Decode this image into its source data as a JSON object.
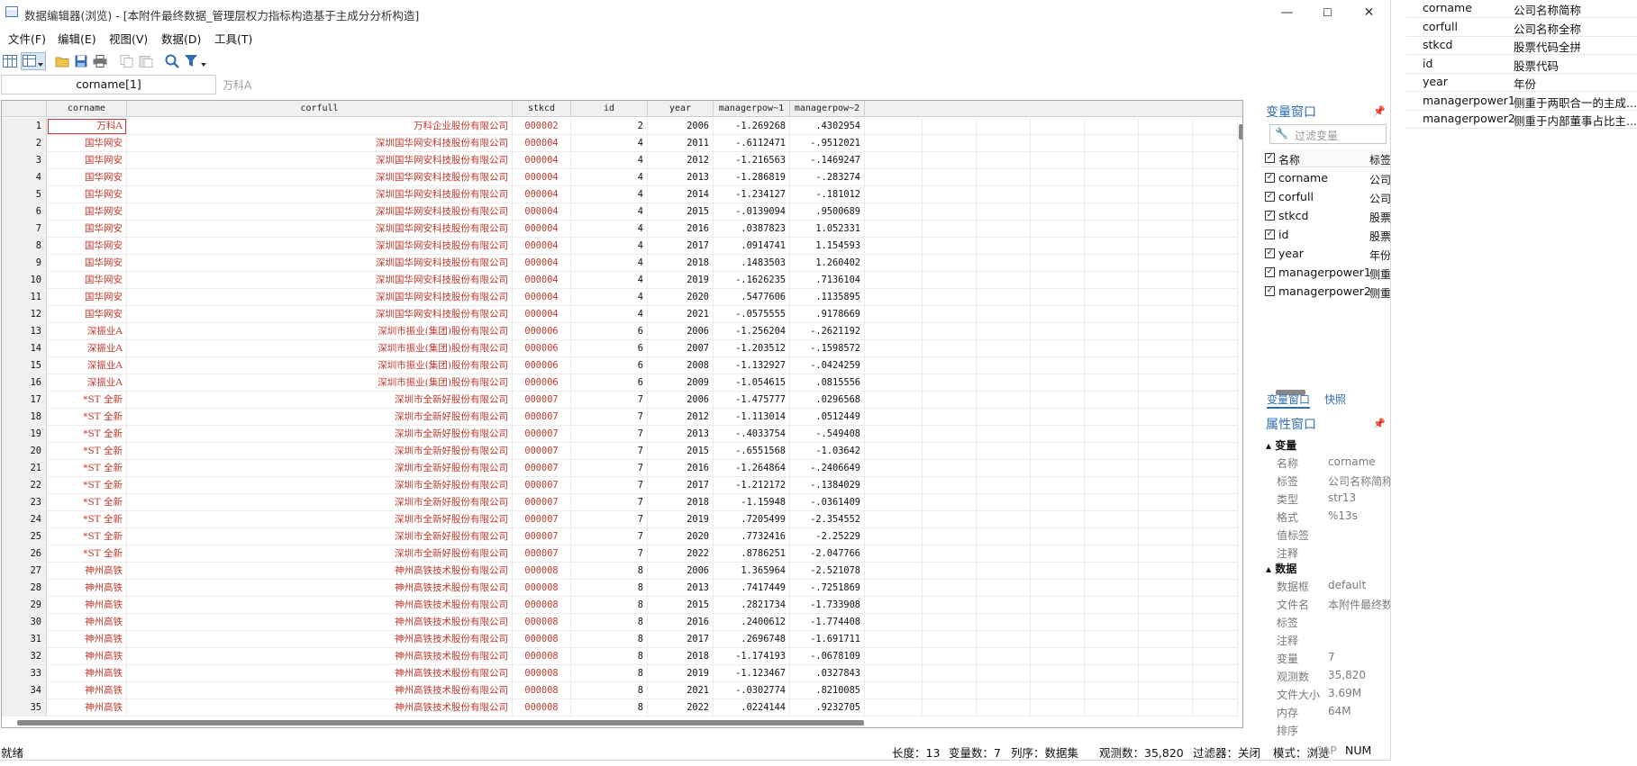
{
  "window": {
    "title": "数据编辑器(浏览) - [本附件最终数据_管理层权力指标构造基于主成分分析构造]",
    "min": "—",
    "max": "☐",
    "close": "✕"
  },
  "menu": [
    "文件(F)",
    "编辑(E)",
    "视图(V)",
    "数据(D)",
    "工具(T)"
  ],
  "toolbar": [
    "data-editor-icon",
    "browse-icon",
    "open-icon",
    "save-icon",
    "print-icon",
    "copy-icon",
    "paste-icon",
    "search-icon",
    "filter-icon"
  ],
  "cell_ref": "corname[1]",
  "cell_value": "万科A",
  "columns": [
    "corname",
    "corfull",
    "stkcd",
    "id",
    "year",
    "managerpow~1",
    "managerpow~2"
  ],
  "rows": [
    [
      "1",
      "万科A",
      "万科企业股份有限公司",
      "000002",
      "2",
      "2006",
      "-1.269268",
      ".4302954"
    ],
    [
      "2",
      "国华网安",
      "深圳国华网安科技股份有限公司",
      "000004",
      "4",
      "2011",
      "-.6112471",
      "-.9512021"
    ],
    [
      "3",
      "国华网安",
      "深圳国华网安科技股份有限公司",
      "000004",
      "4",
      "2012",
      "-1.216563",
      "-.1469247"
    ],
    [
      "4",
      "国华网安",
      "深圳国华网安科技股份有限公司",
      "000004",
      "4",
      "2013",
      "-1.286819",
      "-.283274"
    ],
    [
      "5",
      "国华网安",
      "深圳国华网安科技股份有限公司",
      "000004",
      "4",
      "2014",
      "-1.234127",
      "-.181012"
    ],
    [
      "6",
      "国华网安",
      "深圳国华网安科技股份有限公司",
      "000004",
      "4",
      "2015",
      "-.0139094",
      ".9500689"
    ],
    [
      "7",
      "国华网安",
      "深圳国华网安科技股份有限公司",
      "000004",
      "4",
      "2016",
      ".0387823",
      "1.052331"
    ],
    [
      "8",
      "国华网安",
      "深圳国华网安科技股份有限公司",
      "000004",
      "4",
      "2017",
      ".0914741",
      "1.154593"
    ],
    [
      "9",
      "国华网安",
      "深圳国华网安科技股份有限公司",
      "000004",
      "4",
      "2018",
      ".1483503",
      "1.260402"
    ],
    [
      "10",
      "国华网安",
      "深圳国华网安科技股份有限公司",
      "000004",
      "4",
      "2019",
      "-.1626235",
      ".7136104"
    ],
    [
      "11",
      "国华网安",
      "深圳国华网安科技股份有限公司",
      "000004",
      "4",
      "2020",
      ".5477606",
      ".1135895"
    ],
    [
      "12",
      "国华网安",
      "深圳国华网安科技股份有限公司",
      "000004",
      "4",
      "2021",
      "-.0575555",
      ".9178669"
    ],
    [
      "13",
      "深振业A",
      "深圳市振业(集团)股份有限公司",
      "000006",
      "6",
      "2006",
      "-1.256204",
      "-.2621192"
    ],
    [
      "14",
      "深振业A",
      "深圳市振业(集团)股份有限公司",
      "000006",
      "6",
      "2007",
      "-1.203512",
      "-.1598572"
    ],
    [
      "15",
      "深振业A",
      "深圳市振业(集团)股份有限公司",
      "000006",
      "6",
      "2008",
      "-1.132927",
      "-.0424259"
    ],
    [
      "16",
      "深振业A",
      "深圳市振业(集团)股份有限公司",
      "000006",
      "6",
      "2009",
      "-1.054615",
      ".0815556"
    ],
    [
      "17",
      "*ST 全新",
      "深圳市全新好股份有限公司",
      "000007",
      "7",
      "2006",
      "-1.475777",
      ".0296568"
    ],
    [
      "18",
      "*ST 全新",
      "深圳市全新好股份有限公司",
      "000007",
      "7",
      "2012",
      "-1.113014",
      ".0512449"
    ],
    [
      "19",
      "*ST 全新",
      "深圳市全新好股份有限公司",
      "000007",
      "7",
      "2013",
      "-.4033754",
      "-.549408"
    ],
    [
      "20",
      "*ST 全新",
      "深圳市全新好股份有限公司",
      "000007",
      "7",
      "2015",
      "-.6551568",
      "-1.03642"
    ],
    [
      "21",
      "*ST 全新",
      "深圳市全新好股份有限公司",
      "000007",
      "7",
      "2016",
      "-1.264864",
      "-.2406649"
    ],
    [
      "22",
      "*ST 全新",
      "深圳市全新好股份有限公司",
      "000007",
      "7",
      "2017",
      "-1.212172",
      "-.1384029"
    ],
    [
      "23",
      "*ST 全新",
      "深圳市全新好股份有限公司",
      "000007",
      "7",
      "2018",
      "-1.15948",
      "-.0361409"
    ],
    [
      "24",
      "*ST 全新",
      "深圳市全新好股份有限公司",
      "000007",
      "7",
      "2019",
      ".7205499",
      "-2.354552"
    ],
    [
      "25",
      "*ST 全新",
      "深圳市全新好股份有限公司",
      "000007",
      "7",
      "2020",
      ".7732416",
      "-2.25229"
    ],
    [
      "26",
      "*ST 全新",
      "深圳市全新好股份有限公司",
      "000007",
      "7",
      "2022",
      ".8786251",
      "-2.047766"
    ],
    [
      "27",
      "神州高铁",
      "神州高铁技术股份有限公司",
      "000008",
      "8",
      "2006",
      "1.365964",
      "-2.521078"
    ],
    [
      "28",
      "神州高铁",
      "神州高铁技术股份有限公司",
      "000008",
      "8",
      "2013",
      ".7417449",
      "-.7251869"
    ],
    [
      "29",
      "神州高铁",
      "神州高铁技术股份有限公司",
      "000008",
      "8",
      "2015",
      ".2821734",
      "-1.733908"
    ],
    [
      "30",
      "神州高铁",
      "神州高铁技术股份有限公司",
      "000008",
      "8",
      "2016",
      ".2400612",
      "-1.774408"
    ],
    [
      "31",
      "神州高铁",
      "神州高铁技术股份有限公司",
      "000008",
      "8",
      "2017",
      ".2696748",
      "-1.691711"
    ],
    [
      "32",
      "神州高铁",
      "神州高铁技术股份有限公司",
      "000008",
      "8",
      "2018",
      "-1.174193",
      "-.0678109"
    ],
    [
      "33",
      "神州高铁",
      "神州高铁技术股份有限公司",
      "000008",
      "8",
      "2019",
      "-1.123467",
      ".0327843"
    ],
    [
      "34",
      "神州高铁",
      "神州高铁技术股份有限公司",
      "000008",
      "8",
      "2021",
      "-.0302774",
      ".8210085"
    ],
    [
      "35",
      "神州高铁",
      "神州高铁技术股份有限公司",
      "000008",
      "8",
      "2022",
      ".0224144",
      ".9232705"
    ]
  ],
  "var_window": {
    "title": "变量窗口",
    "filter_placeholder": "过滤变量",
    "col_name": "名称",
    "col_label": "标签",
    "vars": [
      {
        "name": "corname",
        "label": "公司"
      },
      {
        "name": "corfull",
        "label": "公司"
      },
      {
        "name": "stkcd",
        "label": "股票"
      },
      {
        "name": "id",
        "label": "股票"
      },
      {
        "name": "year",
        "label": "年份"
      },
      {
        "name": "managerpower1",
        "label": "侧重"
      },
      {
        "name": "managerpower2",
        "label": "侧重"
      }
    ],
    "tab_vars": "变量窗口",
    "tab_snap": "快照"
  },
  "props": {
    "title": "属性窗口",
    "sec_var": "变量",
    "var_rows": [
      {
        "k": "名称",
        "v": "corname"
      },
      {
        "k": "标签",
        "v": "公司名称简称"
      },
      {
        "k": "类型",
        "v": "str13"
      },
      {
        "k": "格式",
        "v": "%13s"
      },
      {
        "k": "值标签",
        "v": ""
      },
      {
        "k": "注释",
        "v": ""
      }
    ],
    "sec_data": "数据",
    "data_rows": [
      {
        "k": "数据框",
        "v": "default"
      },
      {
        "k": "文件名",
        "v": "本附件最终数"
      },
      {
        "k": "标签",
        "v": ""
      },
      {
        "k": "注释",
        "v": ""
      },
      {
        "k": "变量",
        "v": "7"
      },
      {
        "k": "观测数",
        "v": "35,820"
      },
      {
        "k": "文件大小",
        "v": "3.69M"
      },
      {
        "k": "内存",
        "v": "64M"
      },
      {
        "k": "排序",
        "v": ""
      }
    ]
  },
  "status": {
    "ready": "就绪",
    "length": "长度：13",
    "nvars": "变量数：7",
    "order": "列序：数据集",
    "nobs": "观测数：35,820",
    "filter": "过滤器：关闭",
    "mode": "模式：浏览",
    "cap": "CAP",
    "num": "NUM"
  },
  "right_list": [
    {
      "k": "corname",
      "v": "公司名称简称"
    },
    {
      "k": "corfull",
      "v": "公司名称全称"
    },
    {
      "k": "stkcd",
      "v": "股票代码全拼"
    },
    {
      "k": "id",
      "v": "股票代码"
    },
    {
      "k": "year",
      "v": "年份"
    },
    {
      "k": "managerpower1",
      "v": "侧重于两职合一的主成..."
    },
    {
      "k": "managerpower2",
      "v": "侧重于内部董事占比主..."
    }
  ],
  "colors": {
    "accent": "#2f6db0",
    "string_red": "#c0392b"
  }
}
